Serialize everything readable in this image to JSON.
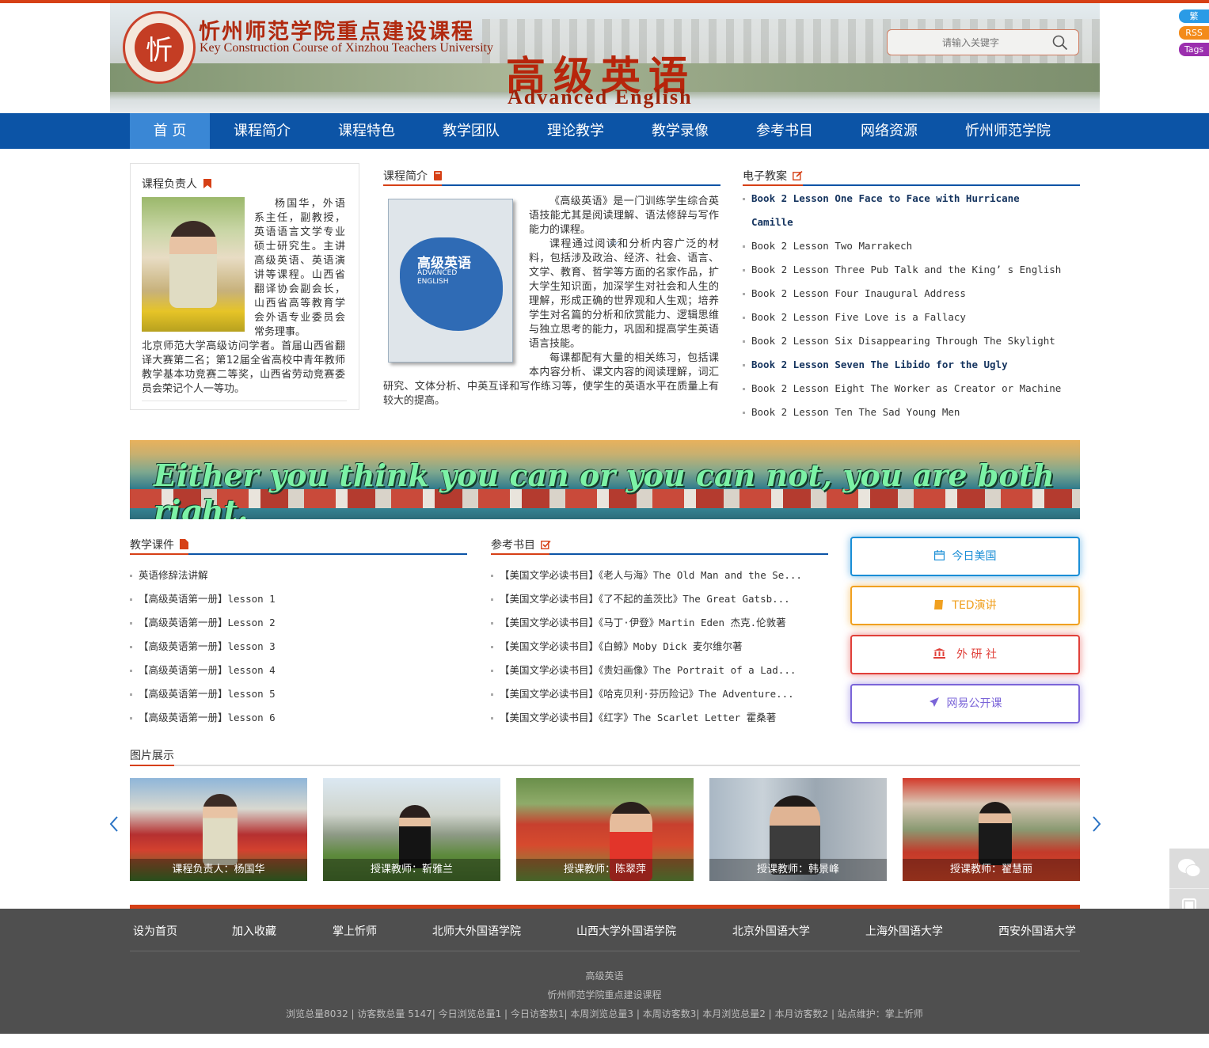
{
  "header": {
    "logo_text": "忻",
    "title_cn": "忻州师范学院重点建设课程",
    "title_en": "Key Construction Course of Xinzhou Teachers University",
    "course_cn": "高级英语",
    "course_en": "Advanced English",
    "search_placeholder": "请输入关键字"
  },
  "side_badges": [
    "繁",
    "RSS",
    "Tags"
  ],
  "nav": [
    "首 页",
    "课程简介",
    "课程特色",
    "教学团队",
    "理论教学",
    "教学录像",
    "参考书目",
    "网络资源",
    "忻州师范学院"
  ],
  "leader": {
    "title": "课程负责人",
    "text_indented": "杨国华，外语系主任，副教授，英语语言文学专业硕士研究生。主讲高级英语、英语演讲等课程。山西省翻译协会副会长，山西省高等教育学会外语专业委员会常务理事。",
    "text_full": "北京师范大学高级访问学者。首届山西省翻译大赛第二名；第12届全省高校中青年教师教学基本功竞赛二等奖，山西省劳动竞赛委员会荣记个人一等功。"
  },
  "intro": {
    "title": "课程简介",
    "book_title_cn": "高级英语",
    "book_title_en": "ADVANCED ENGLISH",
    "para1": "《高级英语》是一门训练学生综合英语技能尤其是阅读理解、语法修辞与写作能力的课程。",
    "para2": "课程通过阅读和分析内容广泛的材料，包括涉及政治、经济、社会、语言、文学、教育、哲学等方面的名家作品，扩大学生知识面，加深学生对社会和人生的理解，形成正确的世界观和人生观；培养学生对名篇的分析和欣赏能力、逻辑思维与独立思考的能力，巩固和提高学生英语语言技能。",
    "para3": "每课都配有大量的相关练习，包括课本内容分析、课文内容的阅读理解，词汇研究、文体分析、中英互译和写作练习等，使学生的英语水平在质量上有较大的提高。"
  },
  "lesson_plans": {
    "title": "电子教案",
    "items": [
      "Book 2 Lesson One Face to Face with Hurricane",
      "Camille",
      "Book 2 Lesson Two Marrakech",
      "Book 2 Lesson Three Pub Talk and the King’ s English",
      "Book 2 Lesson Four Inaugural Address",
      "Book 2 Lesson Five Love is a Fallacy",
      "Book 2 Lesson Six Disappearing Through The Skylight",
      "Book 2 Lesson Seven The Libido for the Ugly",
      "Book 2 Lesson Eight The Worker as Creator or Machine",
      "Book 2 Lesson Ten The Sad Young Men"
    ]
  },
  "banner_text": "Either you think you can or you can not, you are both right.",
  "courseware": {
    "title": "教学课件",
    "items": [
      "英语修辞法讲解",
      "【高级英语第一册】lesson 1",
      "【高级英语第一册】Lesson 2",
      "【高级英语第一册】lesson 3",
      "【高级英语第一册】lesson 4",
      "【高级英语第一册】lesson 5",
      "【高级英语第一册】lesson 6"
    ]
  },
  "references": {
    "title": "参考书目",
    "items": [
      "【美国文学必读书目】《老人与海》The Old Man and the Se...",
      "【美国文学必读书目】《了不起的盖茨比》The Great Gatsb...",
      "【美国文学必读书目】《马丁·伊登》Martin Eden 杰克.伦敦著",
      "【美国文学必读书目】《白鲸》Moby Dick 麦尔维尔著",
      "【美国文学必读书目】《贵妇画像》The Portrait of a Lad...",
      "【美国文学必读书目】《哈克贝利·芬历险记》The Adventure...",
      "【美国文学必读书目】《红字》The Scarlet Letter 霍桑著"
    ]
  },
  "side_buttons": [
    {
      "label": "今日美国",
      "color": "#1a8ed6"
    },
    {
      "label": "TED演讲",
      "color": "#f0a020"
    },
    {
      "label": "外 研 社",
      "color": "#e0403a"
    },
    {
      "label": "网易公开课",
      "color": "#7a64d8"
    }
  ],
  "gallery": {
    "title": "图片展示",
    "items": [
      "课程负责人：杨国华",
      "授课教师：靳雅兰",
      "授课教师：陈翠萍",
      "授课教师：韩景峰",
      "授课教师：翟慧丽"
    ]
  },
  "footer": {
    "links": [
      "设为首页",
      "加入收藏",
      "掌上忻师",
      "北师大外国语学院",
      "山西大学外国语学院",
      "北京外国语大学",
      "上海外国语大学",
      "西安外国语大学"
    ],
    "line1": "高级英语",
    "line2": "忻州师范学院重点建设课程",
    "line3": "浏览总量8032 | 访客数总量 5147| 今日浏览总量1 | 今日访客数1| 本周浏览总量3 | 本周访客数3| 本月浏览总量2 | 本月访客数2 | 站点维护：掌上忻师"
  },
  "colors": {
    "nav": "#0c54a6",
    "accent": "#d64016",
    "footer": "#4f4f4f"
  }
}
